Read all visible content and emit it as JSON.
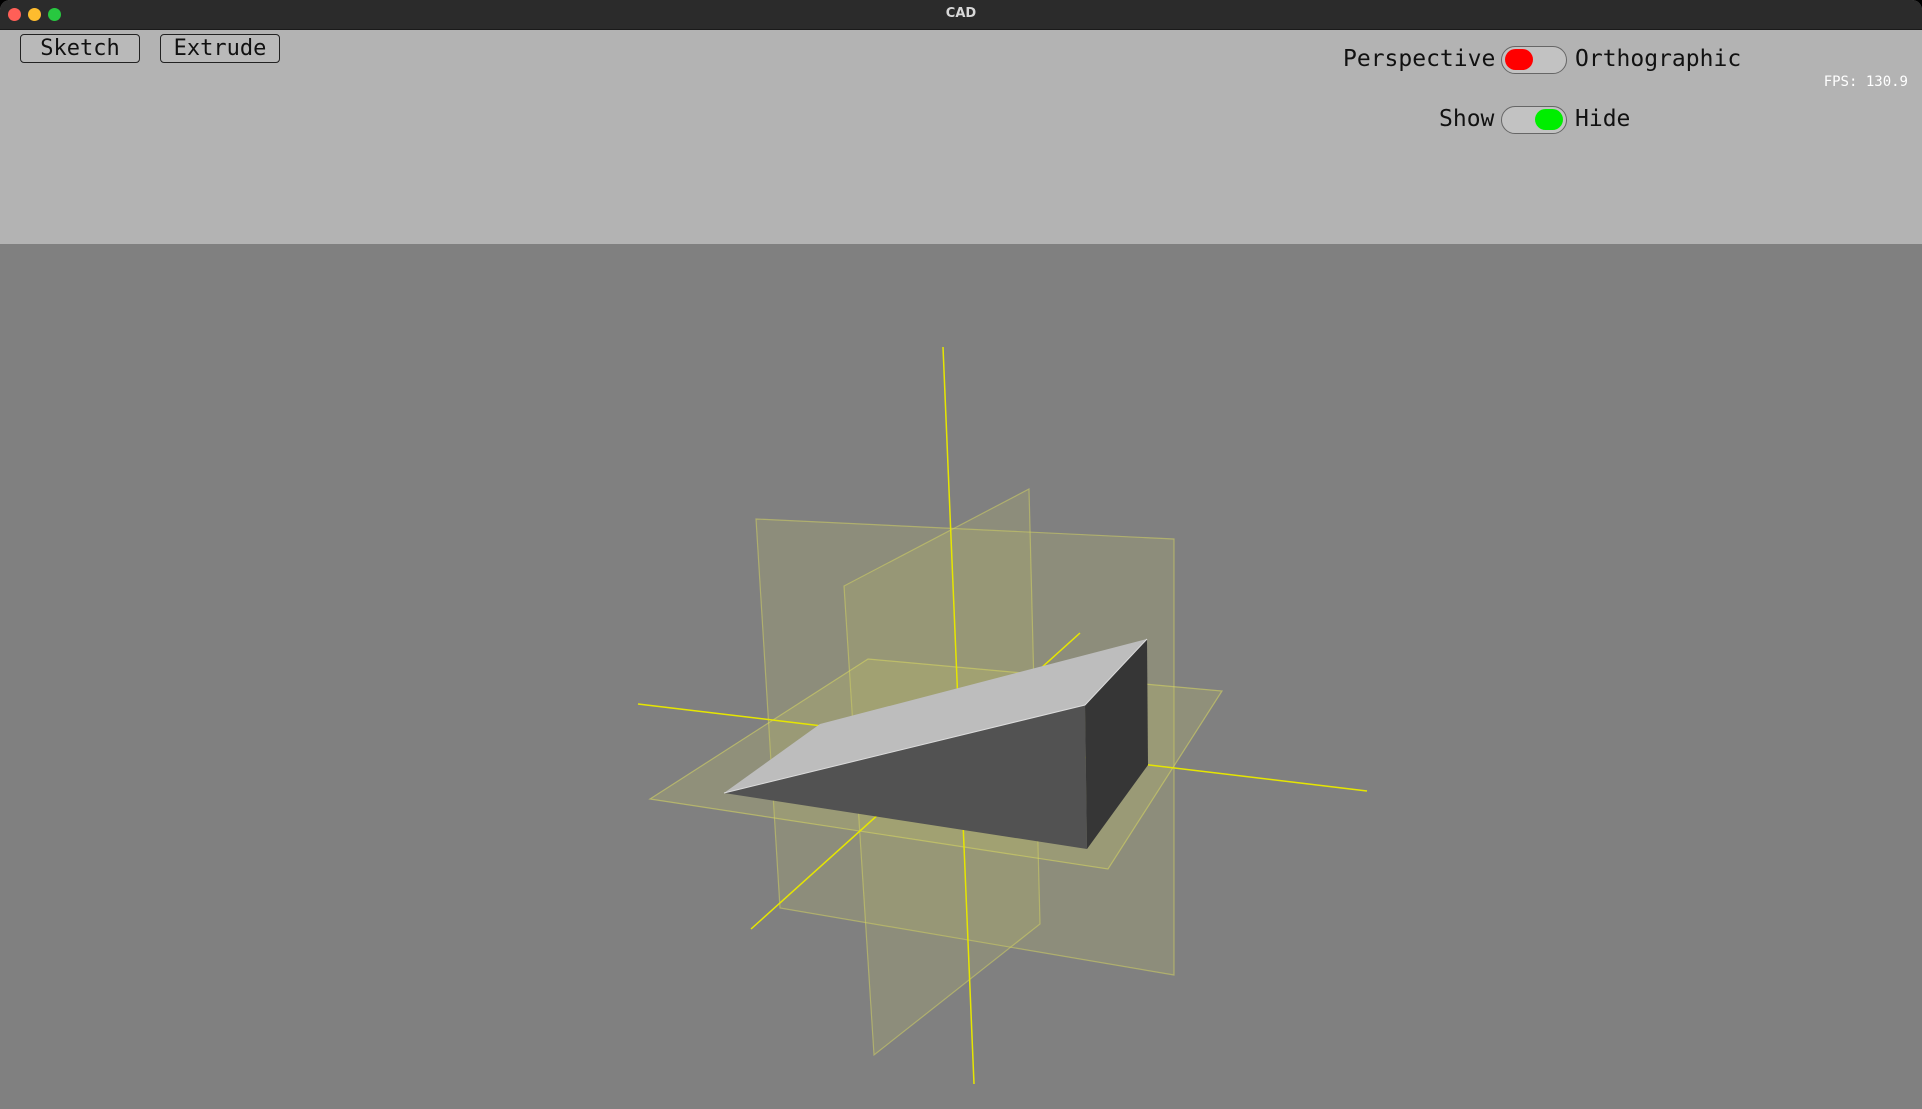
{
  "window": {
    "title": "CAD"
  },
  "toolbar": {
    "sketch_label": "Sketch",
    "extrude_label": "Extrude"
  },
  "projection_toggle": {
    "left_label": "Perspective",
    "right_label": "Orthographic",
    "state": "Perspective",
    "knob_color": "#ff0000"
  },
  "visibility_toggle": {
    "left_label": "Show",
    "right_label": "Hide",
    "state": "Hide",
    "knob_color": "#00ee00"
  },
  "fps": {
    "text": "FPS: 130.9"
  },
  "colors": {
    "toolbar_bg": "#b3b3b3",
    "viewport_bg": "#808080",
    "axis": "#e6e600",
    "plane_fill": "#c8c864",
    "solid_top": "#bdbdbd",
    "solid_front": "#525252",
    "solid_side": "#363636"
  }
}
